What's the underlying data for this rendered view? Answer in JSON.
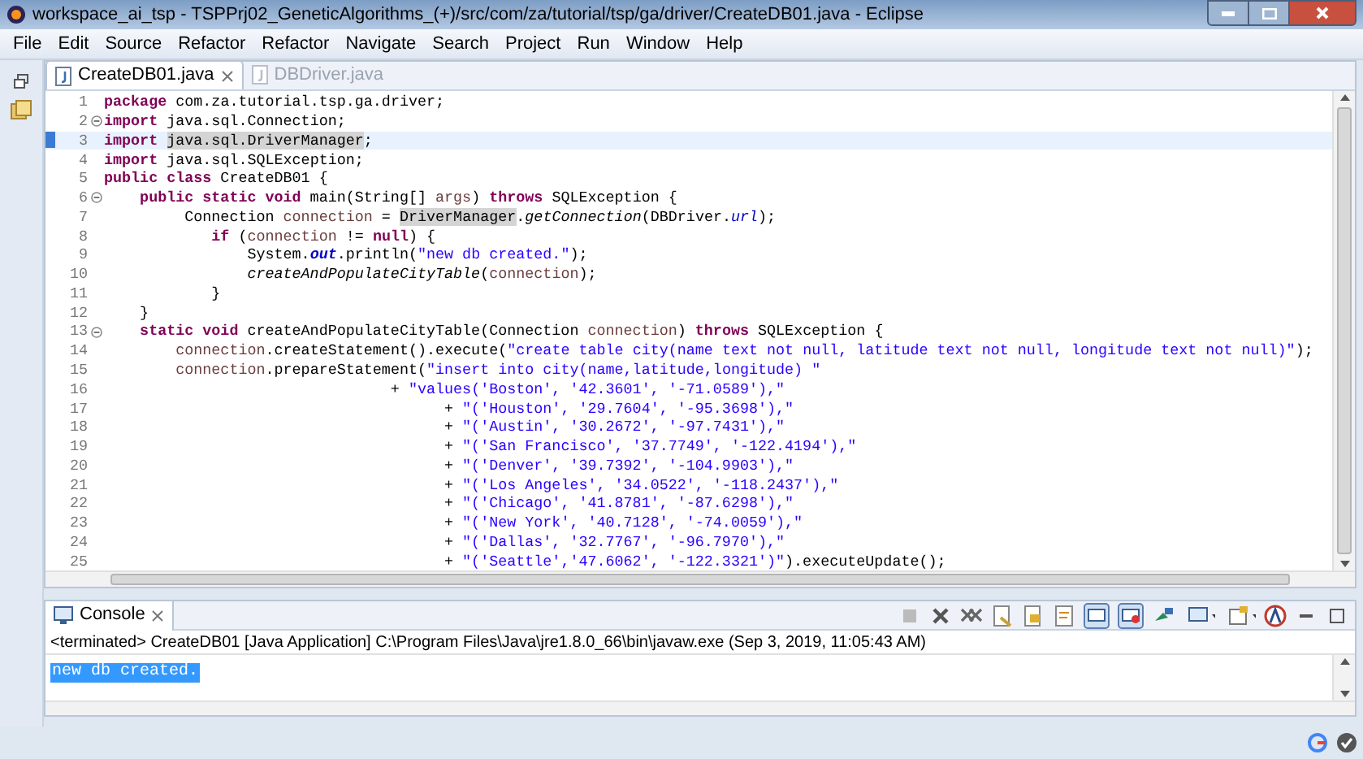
{
  "window": {
    "title": "workspace_ai_tsp - TSPPrj02_GeneticAlgorithms_(+)/src/com/za/tutorial/tsp/ga/driver/CreateDB01.java - Eclipse"
  },
  "menu": [
    "File",
    "Edit",
    "Source",
    "Refactor",
    "Refactor",
    "Navigate",
    "Search",
    "Project",
    "Run",
    "Window",
    "Help"
  ],
  "editor": {
    "tabs": [
      {
        "label": "CreateDB01.java",
        "selected": true
      },
      {
        "label": "DBDriver.java",
        "selected": false
      }
    ],
    "lines": [
      {
        "number": "1",
        "fold": false,
        "current": false,
        "segments": [
          {
            "kind": "keyword",
            "text": "package"
          },
          {
            "kind": "plain",
            "text": " com.za.tutorial.tsp.ga.driver;"
          }
        ]
      },
      {
        "number": "2",
        "fold": true,
        "current": false,
        "segments": [
          {
            "kind": "keyword",
            "text": "import"
          },
          {
            "kind": "plain",
            "text": " java.sql.Connection;"
          }
        ]
      },
      {
        "number": "3",
        "fold": false,
        "current": true,
        "segments": [
          {
            "kind": "keyword",
            "text": "import "
          },
          {
            "kind": "occurrence",
            "text": "java.sql.DriverManager"
          },
          {
            "kind": "plain",
            "text": ";"
          }
        ]
      },
      {
        "number": "4",
        "fold": false,
        "current": false,
        "segments": [
          {
            "kind": "keyword",
            "text": "import"
          },
          {
            "kind": "plain",
            "text": " java.sql.SQLException;"
          }
        ]
      },
      {
        "number": "5",
        "fold": false,
        "current": false,
        "segments": [
          {
            "kind": "keyword",
            "text": "public class"
          },
          {
            "kind": "plain",
            "text": " CreateDB01 {"
          }
        ]
      },
      {
        "number": "6",
        "fold": true,
        "current": false,
        "segments": [
          {
            "kind": "keyword",
            "text": "    public static void"
          },
          {
            "kind": "plain",
            "text": " main(String[] "
          },
          {
            "kind": "variable",
            "text": "args"
          },
          {
            "kind": "plain",
            "text": ") "
          },
          {
            "kind": "keyword",
            "text": "throws"
          },
          {
            "kind": "plain",
            "text": " SQLException {"
          }
        ]
      },
      {
        "number": "7",
        "fold": false,
        "current": false,
        "segments": [
          {
            "kind": "plain",
            "text": "         Connection "
          },
          {
            "kind": "variable",
            "text": "connection"
          },
          {
            "kind": "plain",
            "text": " = "
          },
          {
            "kind": "occurrence",
            "text": "DriverManager"
          },
          {
            "kind": "plain",
            "text": "."
          },
          {
            "kind": "static-method",
            "text": "getConnection"
          },
          {
            "kind": "plain",
            "text": "(DBDriver."
          },
          {
            "kind": "field",
            "text": "url"
          },
          {
            "kind": "plain",
            "text": ");"
          }
        ]
      },
      {
        "number": "8",
        "fold": false,
        "current": false,
        "segments": [
          {
            "kind": "keyword",
            "text": "            if"
          },
          {
            "kind": "plain",
            "text": " ("
          },
          {
            "kind": "variable",
            "text": "connection"
          },
          {
            "kind": "plain",
            "text": " != "
          },
          {
            "kind": "keyword",
            "text": "null"
          },
          {
            "kind": "plain",
            "text": ") {"
          }
        ]
      },
      {
        "number": "9",
        "fold": false,
        "current": false,
        "segments": [
          {
            "kind": "plain",
            "text": "                System."
          },
          {
            "kind": "static-field",
            "text": "out"
          },
          {
            "kind": "plain",
            "text": ".println("
          },
          {
            "kind": "string",
            "text": "\"new db created.\""
          },
          {
            "kind": "plain",
            "text": ");"
          }
        ]
      },
      {
        "number": "10",
        "fold": false,
        "current": false,
        "segments": [
          {
            "kind": "static-method",
            "text": "                createAndPopulateCityTable"
          },
          {
            "kind": "plain",
            "text": "("
          },
          {
            "kind": "variable",
            "text": "connection"
          },
          {
            "kind": "plain",
            "text": ");"
          }
        ]
      },
      {
        "number": "11",
        "fold": false,
        "current": false,
        "segments": [
          {
            "kind": "plain",
            "text": "            }"
          }
        ]
      },
      {
        "number": "12",
        "fold": false,
        "current": false,
        "segments": [
          {
            "kind": "plain",
            "text": "    }"
          }
        ]
      },
      {
        "number": "13",
        "fold": true,
        "current": false,
        "segments": [
          {
            "kind": "keyword",
            "text": "    static void"
          },
          {
            "kind": "plain",
            "text": " createAndPopulateCityTable(Connection "
          },
          {
            "kind": "variable",
            "text": "connection"
          },
          {
            "kind": "plain",
            "text": ") "
          },
          {
            "kind": "keyword",
            "text": "throws"
          },
          {
            "kind": "plain",
            "text": " SQLException {"
          }
        ]
      },
      {
        "number": "14",
        "fold": false,
        "current": false,
        "segments": [
          {
            "kind": "variable",
            "text": "        connection"
          },
          {
            "kind": "plain",
            "text": ".createStatement().execute("
          },
          {
            "kind": "string",
            "text": "\"create table city(name text not null, latitude text not null, longitude text not null)\""
          },
          {
            "kind": "plain",
            "text": ");"
          }
        ]
      },
      {
        "number": "15",
        "fold": false,
        "current": false,
        "segments": [
          {
            "kind": "variable",
            "text": "        connection"
          },
          {
            "kind": "plain",
            "text": ".prepareStatement("
          },
          {
            "kind": "string",
            "text": "\"insert into city(name,latitude,longitude) \""
          }
        ]
      },
      {
        "number": "16",
        "fold": false,
        "current": false,
        "segments": [
          {
            "kind": "plain",
            "text": "                                + "
          },
          {
            "kind": "string",
            "text": "\"values('Boston', '42.3601', '-71.0589'),\""
          }
        ]
      },
      {
        "number": "17",
        "fold": false,
        "current": false,
        "segments": [
          {
            "kind": "plain",
            "text": "                                      + "
          },
          {
            "kind": "string",
            "text": "\"('Houston', '29.7604', '-95.3698'),\""
          }
        ]
      },
      {
        "number": "18",
        "fold": false,
        "current": false,
        "segments": [
          {
            "kind": "plain",
            "text": "                                      + "
          },
          {
            "kind": "string",
            "text": "\"('Austin', '30.2672', '-97.7431'),\""
          }
        ]
      },
      {
        "number": "19",
        "fold": false,
        "current": false,
        "segments": [
          {
            "kind": "plain",
            "text": "                                      + "
          },
          {
            "kind": "string",
            "text": "\"('San Francisco', '37.7749', '-122.4194'),\""
          }
        ]
      },
      {
        "number": "20",
        "fold": false,
        "current": false,
        "segments": [
          {
            "kind": "plain",
            "text": "                                      + "
          },
          {
            "kind": "string",
            "text": "\"('Denver', '39.7392', '-104.9903'),\""
          }
        ]
      },
      {
        "number": "21",
        "fold": false,
        "current": false,
        "segments": [
          {
            "kind": "plain",
            "text": "                                      + "
          },
          {
            "kind": "string",
            "text": "\"('Los Angeles', '34.0522', '-118.2437'),\""
          }
        ]
      },
      {
        "number": "22",
        "fold": false,
        "current": false,
        "segments": [
          {
            "kind": "plain",
            "text": "                                      + "
          },
          {
            "kind": "string",
            "text": "\"('Chicago', '41.8781', '-87.6298'),\""
          }
        ]
      },
      {
        "number": "23",
        "fold": false,
        "current": false,
        "segments": [
          {
            "kind": "plain",
            "text": "                                      + "
          },
          {
            "kind": "string",
            "text": "\"('New York', '40.7128', '-74.0059'),\""
          }
        ]
      },
      {
        "number": "24",
        "fold": false,
        "current": false,
        "segments": [
          {
            "kind": "plain",
            "text": "                                      + "
          },
          {
            "kind": "string",
            "text": "\"('Dallas', '32.7767', '-96.7970'),\""
          }
        ]
      },
      {
        "number": "25",
        "fold": false,
        "current": false,
        "segments": [
          {
            "kind": "plain",
            "text": "                                      + "
          },
          {
            "kind": "string",
            "text": "\"('Seattle','47.6062', '-122.3321')\""
          },
          {
            "kind": "plain",
            "text": ").executeUpdate();"
          }
        ]
      }
    ]
  },
  "console": {
    "tab": "Console",
    "status": "<terminated> CreateDB01 [Java Application] C:\\Program Files\\Java\\jre1.8.0_66\\bin\\javaw.exe (Sep 3, 2019, 11:05:43 AM)",
    "output": [
      {
        "text": "new db created.",
        "selected": true
      }
    ]
  }
}
